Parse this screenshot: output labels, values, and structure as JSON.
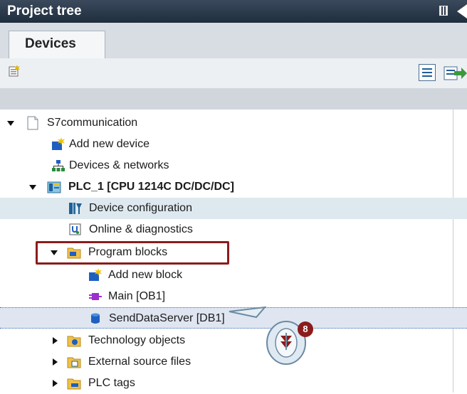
{
  "panel": {
    "title": "Project tree"
  },
  "tabs": [
    {
      "label": "Devices"
    }
  ],
  "tree": {
    "rows": [
      {
        "label": "S7communication",
        "icon": "project-icon",
        "expanded": true
      },
      {
        "label": "Add new device",
        "icon": "add-device-icon"
      },
      {
        "label": "Devices & networks",
        "icon": "network-icon"
      },
      {
        "label": "PLC_1 [CPU 1214C DC/DC/DC]",
        "icon": "plc-icon",
        "expanded": true
      },
      {
        "label": "Device configuration",
        "icon": "device-config-icon"
      },
      {
        "label": "Online & diagnostics",
        "icon": "online-diagnostics-icon"
      },
      {
        "label": "Program blocks",
        "icon": "folder-icon",
        "expanded": true
      },
      {
        "label": "Add new block",
        "icon": "add-block-icon"
      },
      {
        "label": "Main [OB1]",
        "icon": "ob-block-icon"
      },
      {
        "label": "SendDataServer [DB1]",
        "icon": "db-block-icon",
        "selected": true
      },
      {
        "label": "Technology objects",
        "icon": "folder-icon",
        "expanded": false
      },
      {
        "label": "External source files",
        "icon": "folder-icon",
        "expanded": false
      },
      {
        "label": "PLC tags",
        "icon": "folder-icon",
        "expanded": false
      }
    ]
  },
  "step_badge": "8",
  "colors": {
    "highlight_box": "#8b1c1c",
    "titlebar": "#1f2d3d",
    "selection": "#dfe6f1"
  }
}
